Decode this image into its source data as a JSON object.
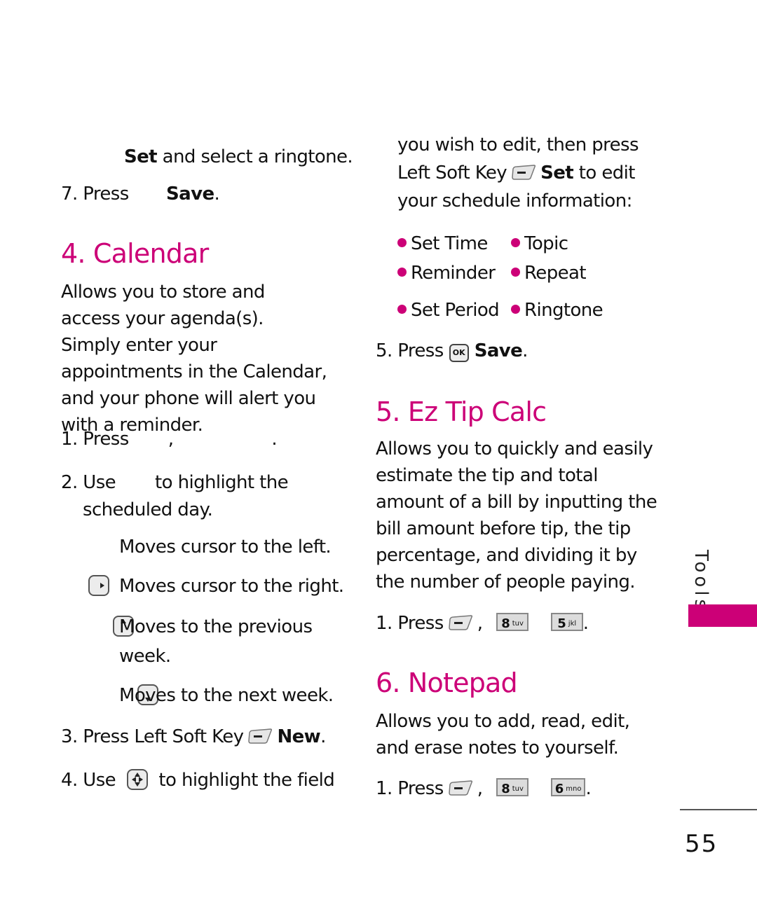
{
  "left_column": {
    "ringtone_line": {
      "bold": "Set",
      "rest": " and select a ringtone."
    },
    "step7": {
      "prefix": "7. Press",
      "bold": "Save",
      "suffix": "."
    },
    "calendar": {
      "title": "4. Calendar",
      "description": "Allows you to store and access your agenda(s). Simply enter your appointments in the Calendar, and your phone will alert you with a reminder.",
      "step1": {
        "prefix": "1. Press",
        "comma": ",",
        "period": "."
      },
      "step2": {
        "prefix": "2. Use",
        "rest": "to highlight the",
        "line2": "scheduled day."
      },
      "nav_items": [
        {
          "icon": "nav-left-icon",
          "text": "Moves cursor to the left."
        },
        {
          "icon": "nav-right-icon",
          "text": "Moves cursor to the right."
        },
        {
          "icon": "nav-up-icon",
          "text": "Moves to the previous",
          "line2": "week."
        },
        {
          "icon": "nav-down-icon",
          "text": "Moves to the next week."
        }
      ],
      "step3": {
        "prefix": "3. Press Left Soft Key",
        "bold": "New",
        "suffix": "."
      },
      "step4": {
        "prefix": "4. Use",
        "rest": "to highlight the field"
      }
    }
  },
  "right_column": {
    "continue_lines": [
      "you wish to edit, then press",
      "Left Soft Key",
      "to edit",
      "your schedule information:"
    ],
    "set_bold": "Set",
    "bullets": [
      "Set Time",
      "Topic",
      "Reminder",
      "Repeat",
      "Set Period",
      "Ringtone"
    ],
    "step5": {
      "prefix": "5. Press",
      "ok_label": "OK",
      "bold": "Save",
      "suffix": "."
    },
    "tipcalc": {
      "title": "5. Ez Tip Calc",
      "description_lines": [
        "Allows you to quickly and easily",
        "estimate the tip and total",
        "amount of a bill by inputting the",
        "bill amount before tip, the tip",
        "percentage, and dividing it by",
        "the number of people paying."
      ],
      "step1": {
        "prefix": "1. Press",
        "comma": ",",
        "key1": {
          "num": "8",
          "letters": "tuv"
        },
        "key2": {
          "num": "5",
          "letters": "jkl"
        },
        "period": "."
      }
    },
    "notepad": {
      "title": "6. Notepad",
      "description_lines": [
        "Allows you to add, read, edit,",
        "and erase notes to yourself."
      ],
      "step1": {
        "prefix": "1. Press",
        "comma": ",",
        "key1": {
          "num": "8",
          "letters": "tuv"
        },
        "key2": {
          "num": "6",
          "letters": "mno"
        },
        "period": "."
      }
    }
  },
  "side_tab": {
    "label": "Tools",
    "color": "#cc0077"
  },
  "page_number": "55",
  "accent_color": "#cc0077"
}
